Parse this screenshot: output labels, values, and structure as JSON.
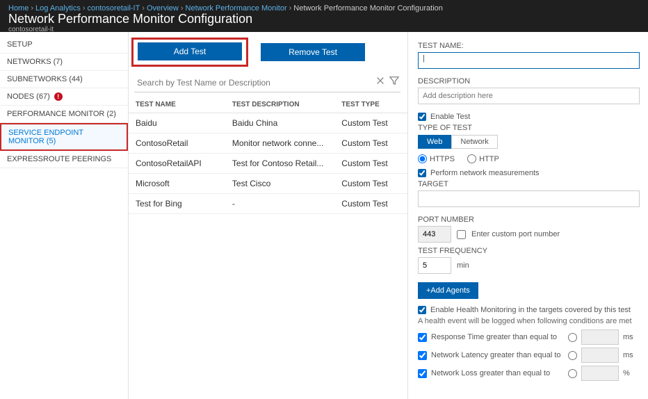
{
  "breadcrumbs": [
    "Home",
    "Log Analytics",
    "contosoretail-IT",
    "Overview",
    "Network Performance Monitor",
    "Network Performance Monitor Configuration"
  ],
  "header": {
    "title": "Network Performance Monitor Configuration",
    "subtitle": "contosoretail-it"
  },
  "sidebar": {
    "items": [
      {
        "label": "SETUP",
        "alert": false
      },
      {
        "label": "NETWORKS (7)",
        "alert": false
      },
      {
        "label": "SUBNETWORKS (44)",
        "alert": false
      },
      {
        "label": "NODES (67)",
        "alert": true
      },
      {
        "label": "PERFORMANCE MONITOR (2)",
        "alert": false
      },
      {
        "label": "SERVICE ENDPOINT MONITOR (5)",
        "alert": false,
        "selected": true
      },
      {
        "label": "EXPRESSROUTE PEERINGS",
        "alert": false
      }
    ]
  },
  "center": {
    "add_button": "Add Test",
    "remove_button": "Remove Test",
    "search_placeholder": "Search by Test Name or Description",
    "columns": [
      "TEST NAME",
      "TEST DESCRIPTION",
      "TEST TYPE"
    ],
    "rows": [
      {
        "name": "Baidu",
        "desc": "Baidu China",
        "type": "Custom Test"
      },
      {
        "name": "ContosoRetail",
        "desc": "Monitor network conne...",
        "type": "Custom Test"
      },
      {
        "name": "ContosoRetailAPI",
        "desc": "Test for Contoso Retail...",
        "type": "Custom Test"
      },
      {
        "name": "Microsoft",
        "desc": "Test Cisco",
        "type": "Custom Test"
      },
      {
        "name": "Test for Bing",
        "desc": "-",
        "type": "Custom Test"
      }
    ]
  },
  "form": {
    "test_name_label": "TEST NAME:",
    "test_name_value": "",
    "description_label": "DESCRIPTION",
    "description_placeholder": "Add description here",
    "enable_test_label": "Enable Test",
    "enable_test_checked": true,
    "type_of_test_label": "TYPE OF TEST",
    "tabs": {
      "web": "Web",
      "network": "Network",
      "active": "web"
    },
    "protocol": {
      "https": "HTTPS",
      "http": "HTTP",
      "selected": "HTTPS"
    },
    "perform_label": "Perform network measurements",
    "perform_checked": true,
    "target_label": "TARGET",
    "target_value": "",
    "port_label": "PORT NUMBER",
    "port_value": "443",
    "custom_port_label": "Enter custom port number",
    "custom_port_checked": false,
    "freq_label": "TEST FREQUENCY",
    "freq_value": "5",
    "freq_unit": "min",
    "add_agents": "+Add Agents",
    "health_label": "Enable Health Monitoring in the targets covered by this test",
    "health_checked": true,
    "health_note": "A health event will be logged when following conditions are met",
    "conditions": [
      {
        "checked": true,
        "text": "Response Time greater than equal to",
        "value": "",
        "unit": "ms"
      },
      {
        "checked": true,
        "text": "Network Latency greater than equal to",
        "value": "",
        "unit": "ms"
      },
      {
        "checked": true,
        "text": "Network Loss greater than equal to",
        "value": "",
        "unit": "%"
      }
    ]
  }
}
